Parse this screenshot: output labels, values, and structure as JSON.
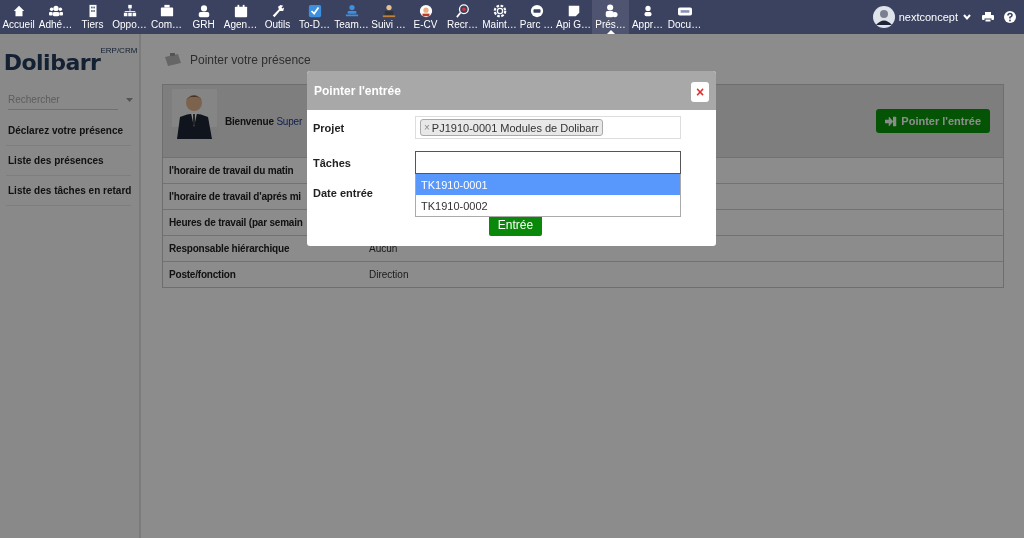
{
  "top_menu": {
    "items": [
      {
        "label": "Accueil",
        "selected": false
      },
      {
        "label": "Adhé…",
        "selected": false
      },
      {
        "label": "Tiers",
        "selected": false
      },
      {
        "label": "Oppo…",
        "selected": false
      },
      {
        "label": "Com…",
        "selected": false
      },
      {
        "label": "GRH",
        "selected": false
      },
      {
        "label": "Agen…",
        "selected": false
      },
      {
        "label": "Outils",
        "selected": false
      },
      {
        "label": "To-D…",
        "selected": false
      },
      {
        "label": "Team…",
        "selected": false
      },
      {
        "label": "Suivi …",
        "selected": false
      },
      {
        "label": "E-CV",
        "selected": false
      },
      {
        "label": "Recr…",
        "selected": false
      },
      {
        "label": "Maint…",
        "selected": false
      },
      {
        "label": "Parc …",
        "selected": false
      },
      {
        "label": "Api G…",
        "selected": false
      },
      {
        "label": "Prés…",
        "selected": true
      },
      {
        "label": "Appr…",
        "selected": false
      },
      {
        "label": "Docu…",
        "selected": false
      }
    ],
    "user": {
      "name": "nextconcept"
    }
  },
  "sidebar": {
    "logo": "Dolibarr",
    "logo_tag": "ERP/CRM",
    "search": {
      "placeholder": "Rechercher"
    },
    "items": [
      "Déclarez votre présence",
      "Liste des présences",
      "Liste des tâches en retard"
    ]
  },
  "page": {
    "title": "Pointer votre présence",
    "welcome": {
      "label": "Bienvenue",
      "user": "Super"
    },
    "action_button": "Pointer l'entrée",
    "rows": [
      {
        "label": "l'horaire de travail du matin"
      },
      {
        "label": "l'horaire de travail d'aprés mi"
      },
      {
        "label": "Heures de travail (par semain"
      },
      {
        "label": "Responsable hiérarchique",
        "value": "Aucun"
      },
      {
        "label": "Poste/fonction",
        "value": "Direction"
      }
    ]
  },
  "dialog": {
    "title": "Pointer l'entrée",
    "close": "×",
    "fields": [
      {
        "label": "Projet",
        "kind": "tags",
        "tags": [
          {
            "remove": "×",
            "label": "PJ1910-0001 Modules de Dolibarr"
          }
        ]
      },
      {
        "label": "Tâches",
        "kind": "search",
        "options": [
          {
            "label": "TK1910-0001",
            "selected": true
          },
          {
            "label": "TK1910-0002",
            "selected": false
          }
        ]
      },
      {
        "label": "Date entrée",
        "kind": "date"
      }
    ],
    "submit": "Entrée"
  }
}
